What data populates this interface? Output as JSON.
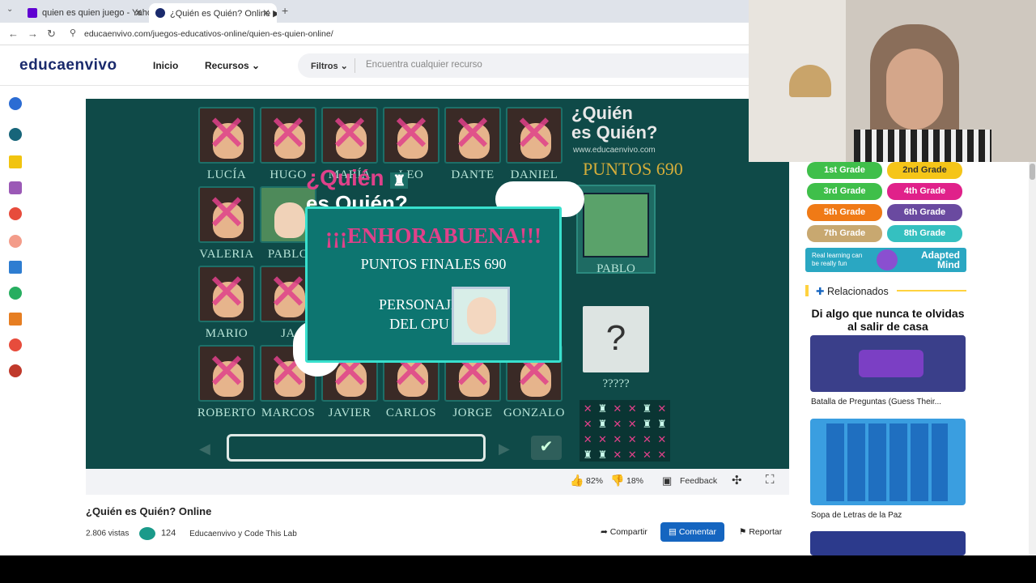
{
  "browser": {
    "tabs": [
      {
        "title": "quien es quien juego - Yahoo S"
      },
      {
        "title": "¿Quién es Quién? Online ▶ El"
      }
    ],
    "new_tab": "+",
    "url": "educaenvivo.com/juegos-educativos-online/quien-es-quien-online/"
  },
  "site": {
    "logo": "educaenvivo",
    "nav": {
      "inicio": "Inicio",
      "recursos": "Recursos ⌄"
    },
    "filter_label": "Filtros ⌄",
    "search_placeholder": "Encuentra cualquier recurso"
  },
  "game": {
    "title_line1": "¿Quién",
    "title_line2": "es Quién?",
    "site_url": "www.educaenvivo.com",
    "points_label": "PUNTOS",
    "points_value": "690",
    "characters": [
      "LUCÍA",
      "HUGO",
      "MARÍA",
      "LEO",
      "DANTE",
      "DANIEL",
      "VALERIA",
      "PABLO",
      "MARIO",
      "JA",
      "ROBERTO",
      "MARCOS",
      "JAVIER",
      "CARLOS",
      "JORGE",
      "GONZALO"
    ],
    "overlay_logo1": "¿Quién",
    "overlay_logo2": "es Quién?",
    "side_selected": "PABLO",
    "side_unknown": "?????",
    "popup": {
      "title": "¡¡¡ENHORABUENA!!!",
      "score": "PUNTOS FINALES 690",
      "character_label_1": "PERSONAJE",
      "character_label_2": "DEL CPU"
    }
  },
  "toolbar": {
    "likes": "82%",
    "dislikes": "18%",
    "feedback": "Feedback"
  },
  "video": {
    "title": "¿Quién es Quién? Online",
    "views": "2.806 vistas",
    "count": "124",
    "authors": "Educaenvivo y Code This Lab",
    "share": "Compartir",
    "comment": "Comentar",
    "report": "Reportar"
  },
  "sidebar": {
    "grades": [
      "1st Grade",
      "2nd Grade",
      "3rd Grade",
      "4th Grade",
      "5th Grade",
      "6th Grade",
      "7th Grade",
      "8th Grade"
    ],
    "grade_colors": [
      "#3fbf4a",
      "#f5c518",
      "#3fbf4a",
      "#e0218a",
      "#f07a16",
      "#6a4aa0",
      "#c8a870",
      "#35c0c0"
    ],
    "ad_text": "Real learning can be really fun",
    "ad_brand": "Adapted Mind",
    "related_label": "Relacionados",
    "related1_title": "Di algo que nunca te olvidas al salir de casa",
    "related1_caption": "Batalla de Preguntas (Guess Their...",
    "related2_caption": "Sopa de Letras de la Paz"
  }
}
